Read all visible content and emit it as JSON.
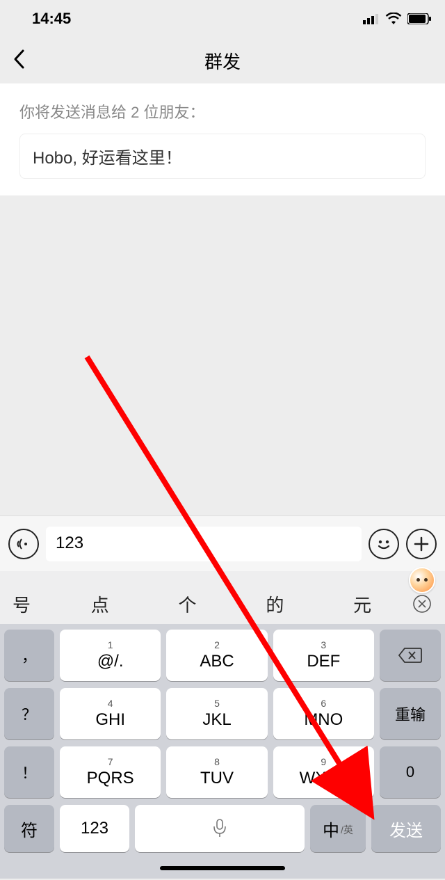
{
  "status": {
    "time": "14:45"
  },
  "nav": {
    "title": "群发"
  },
  "content": {
    "recipients_label": "你将发送消息给 2 位朋友：",
    "recipients_names": "Hobo, 好运看这里！"
  },
  "input": {
    "value": "123"
  },
  "suggestions": {
    "s0": "号",
    "s1": "点",
    "s2": "个",
    "s3": "的",
    "s4": "元"
  },
  "keyboard": {
    "r1": {
      "punct": "，",
      "k1_num": "1",
      "k1_txt": "@/.",
      "k2_num": "2",
      "k2_txt": "ABC",
      "k3_num": "3",
      "k3_txt": "DEF"
    },
    "r2": {
      "punct": "？",
      "k1_num": "4",
      "k1_txt": "GHI",
      "k2_num": "5",
      "k2_txt": "JKL",
      "k3_num": "6",
      "k3_txt": "MNO",
      "side": "重输"
    },
    "r3": {
      "punct": "！",
      "k1_num": "7",
      "k1_txt": "PQRS",
      "k2_num": "8",
      "k2_txt": "TUV",
      "k3_num": "9",
      "k3_txt": "WXYZ",
      "side": "0"
    },
    "bottom": {
      "sym": "符",
      "num": "123",
      "lang_main": "中",
      "lang_sub": "/英",
      "send": "发送"
    }
  }
}
